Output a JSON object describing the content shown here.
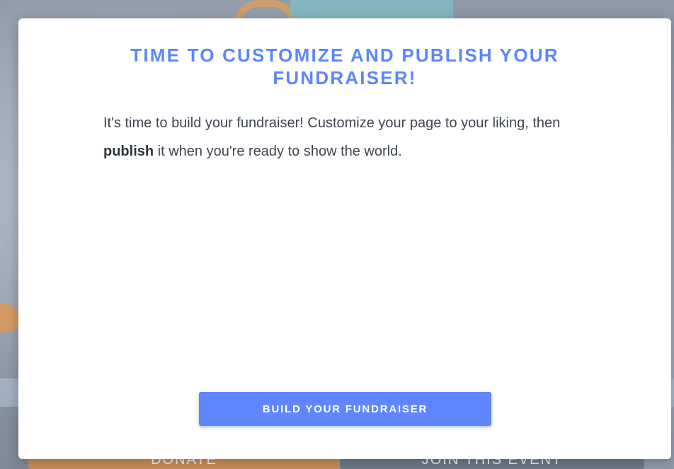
{
  "background": {
    "donate_label": "DONATE",
    "join_label": "JOIN THIS EVENT"
  },
  "modal": {
    "title": "TIME TO CUSTOMIZE AND PUBLISH YOUR FUNDRAISER!",
    "body_part1": "It's time to build your fundraiser! Customize your page to your liking, then ",
    "body_bold": "publish",
    "body_part2": " it when you're ready to show the world.",
    "cta_label": "BUILD YOUR FUNDRAISER"
  },
  "colors": {
    "accent": "#5f86ff",
    "title": "#5b86ff",
    "text": "#3f4651"
  }
}
